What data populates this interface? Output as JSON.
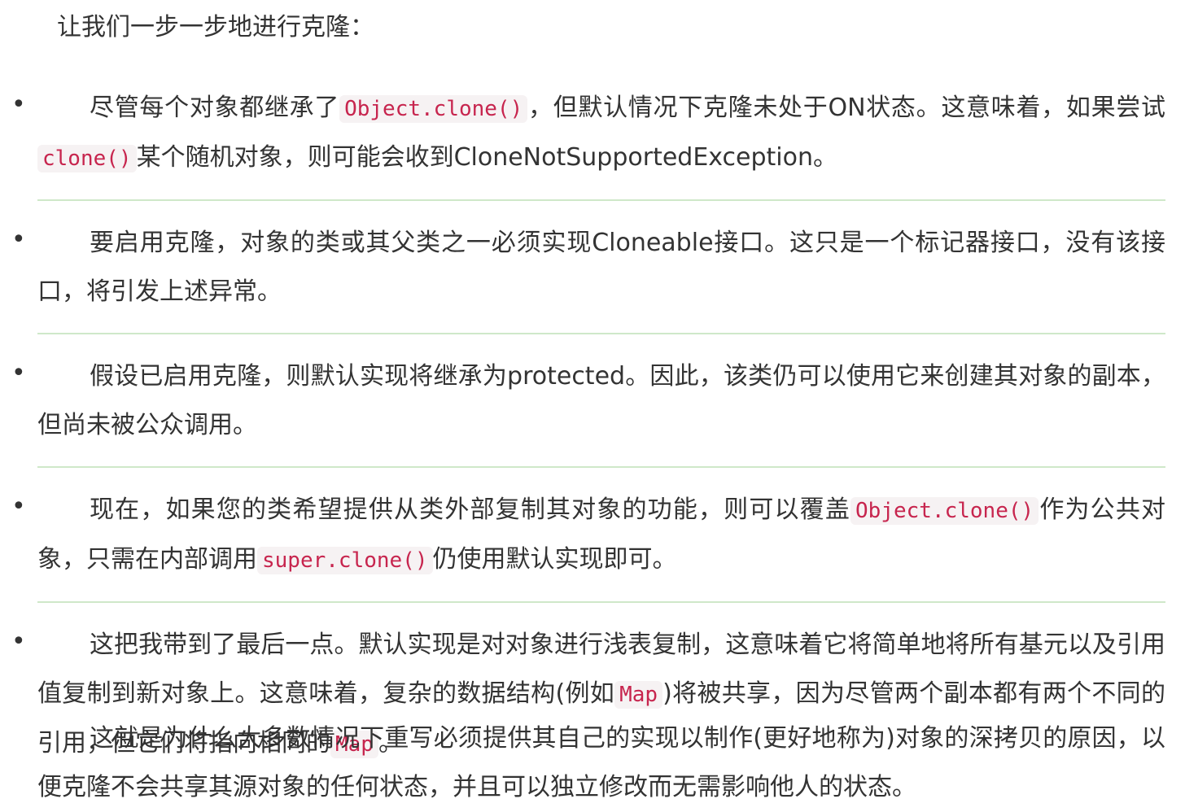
{
  "intro": "让我们一步一步地进行克隆：",
  "bullet_glyph": "•",
  "items": [
    {
      "parts": [
        "尽管每个对象都继承了",
        "Object.clone()",
        "，但默认情况下克隆未处于ON状态。这意味着，如果尝试",
        "clone()",
        "某个随机对象，则可能会收到CloneNotSupportedException。"
      ]
    },
    {
      "parts": [
        "要启用克隆，对象的类或其父类之一必须实现Cloneable接口。这只是一个标记器接口，没有该接口，将引发上述异常。"
      ]
    },
    {
      "parts": [
        "假设已启用克隆，则默认实现将继承为protected。因此，该类仍可以使用它来创建其对象的副本，但尚未被公众调用。"
      ]
    },
    {
      "parts": [
        "现在，如果您的类希望提供从类外部复制其对象的功能，则可以覆盖",
        "Object.clone()",
        "作为公共对象，只需在内部调用",
        "super.clone()",
        "仍使用默认实现即可。"
      ]
    },
    {
      "parts": [
        "这把我带到了最后一点。默认实现是对对象进行浅表复制，这意味着它将简单地将所有基元以及引用值复制到新对象上。这意味着，复杂的数据结构(例如",
        "Map",
        ")将被共享，因为尽管两个副本都有两个不同的引用，但它们将指向相同的",
        "Map",
        "。"
      ]
    }
  ],
  "final": "这就是为什么大多数情况下重写必须提供其自己的实现以制作(更好地称为)对象的深拷贝的原因，以便克隆不会共享其源对象的任何状态，并且可以独立修改而无需影响他人的状态。"
}
